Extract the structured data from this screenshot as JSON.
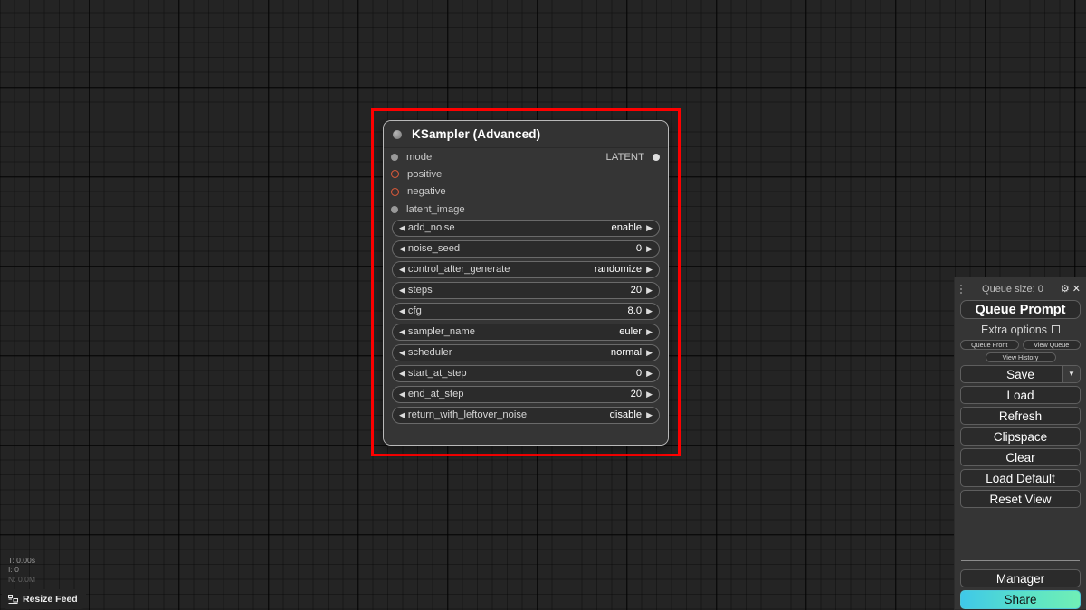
{
  "canvas": {
    "background_color": "#242424",
    "grid_color": "#000000"
  },
  "node": {
    "title": "KSampler (Advanced)",
    "collapse_icon": "circle-dot-icon",
    "selection_color": "#ff0000",
    "inputs": [
      {
        "label": "model",
        "dot": "filled",
        "color": "#999999"
      },
      {
        "label": "positive",
        "dot": "ring",
        "color": "#e05c3a"
      },
      {
        "label": "negative",
        "dot": "ring",
        "color": "#e05c3a"
      },
      {
        "label": "latent_image",
        "dot": "filled",
        "color": "#999999"
      }
    ],
    "outputs": [
      {
        "label": "LATENT",
        "dot": "filled",
        "color": "#dddddd"
      }
    ],
    "widgets": [
      {
        "name": "add_noise",
        "value": "enable"
      },
      {
        "name": "noise_seed",
        "value": "0"
      },
      {
        "name": "control_after_generate",
        "value": "randomize"
      },
      {
        "name": "steps",
        "value": "20"
      },
      {
        "name": "cfg",
        "value": "8.0"
      },
      {
        "name": "sampler_name",
        "value": "euler"
      },
      {
        "name": "scheduler",
        "value": "normal"
      },
      {
        "name": "start_at_step",
        "value": "0"
      },
      {
        "name": "end_at_step",
        "value": "20"
      },
      {
        "name": "return_with_leftover_noise",
        "value": "disable"
      }
    ],
    "arrow_left": "◀",
    "arrow_right": "▶"
  },
  "stats": {
    "time": "T: 0.00s",
    "iterations": "I: 0",
    "clipped_line": "N: 0.0M"
  },
  "resize_feed": {
    "label": "Resize Feed",
    "icon": "resize-icon"
  },
  "menu": {
    "queue_size_label": "Queue size: 0",
    "gear_icon": "⚙",
    "close_icon": "✕",
    "queue_prompt_label": "Queue Prompt",
    "extra_options_label": "Extra options",
    "extra_options_checked": false,
    "queue_front_label": "Queue Front",
    "view_queue_label": "View Queue",
    "view_history_label": "View History",
    "save_label": "Save",
    "save_caret": "▼",
    "load_label": "Load",
    "refresh_label": "Refresh",
    "clipspace_label": "Clipspace",
    "clear_label": "Clear",
    "load_default_label": "Load Default",
    "reset_view_label": "Reset View",
    "manager_label": "Manager",
    "share_label": "Share",
    "share_gradient_from": "#3fc8e8",
    "share_gradient_to": "#70eeb6"
  }
}
